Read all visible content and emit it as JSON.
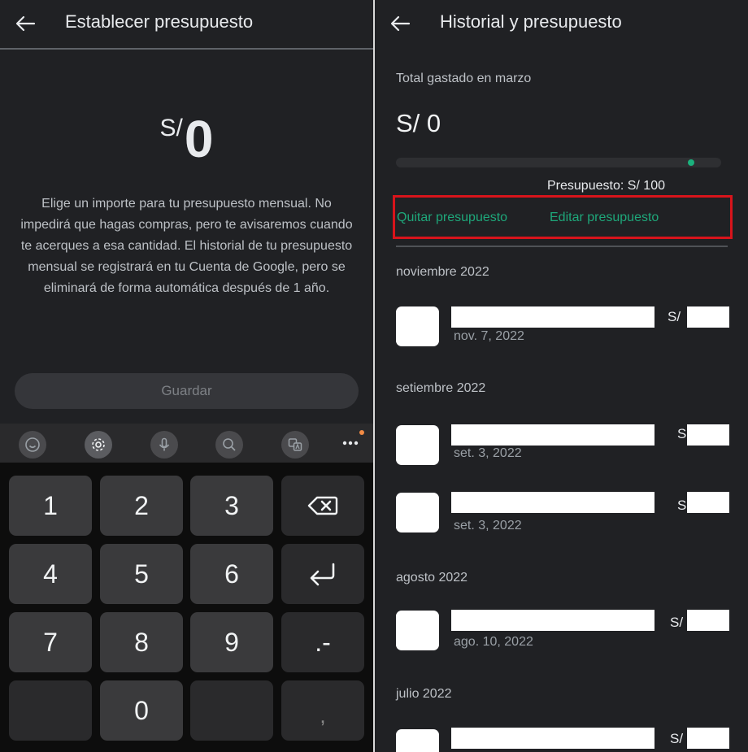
{
  "left": {
    "title": "Establecer presupuesto",
    "amount": {
      "currency": "S/",
      "value": "0"
    },
    "description": "Elige un importe para tu presupuesto mensual. No impedirá que hagas compras, pero te avisaremos cuando te acerques a esa cantidad. El historial de tu presupuesto mensual se registrará en tu Cuenta de Google, pero se eliminará de forma automática después de 1 año.",
    "save_label": "Guardar",
    "keyboard": {
      "toolbar_icons": [
        "emoji-icon",
        "settings-icon",
        "mic-icon",
        "search-icon",
        "translate-icon"
      ],
      "keys": [
        "1",
        "2",
        "3",
        "4",
        "5",
        "6",
        "7",
        "8",
        "9",
        ".-",
        "0",
        ","
      ]
    }
  },
  "right": {
    "title": "Historial y presupuesto",
    "total_label": "Total gastado en marzo",
    "total_value": "S/ 0",
    "budget_label": "Presupuesto: S/ 100",
    "progress": 0,
    "remove_label": "Quitar presupuesto",
    "edit_label": "Editar presupuesto",
    "months": [
      {
        "label": "noviembre 2022",
        "items": [
          {
            "date": "nov. 7, 2022",
            "currency": "S/"
          }
        ]
      },
      {
        "label": "setiembre 2022",
        "items": [
          {
            "date": "set. 3, 2022",
            "currency": "S"
          },
          {
            "date": "set. 3, 2022",
            "currency": "S"
          }
        ]
      },
      {
        "label": "agosto 2022",
        "items": [
          {
            "date": "ago. 10, 2022",
            "currency": "S/"
          }
        ]
      },
      {
        "label": "julio 2022",
        "items": [
          {
            "date": "",
            "currency": "S/"
          }
        ]
      }
    ],
    "colors": {
      "accent": "#1ea77a",
      "highlight_box": "#d8141b"
    }
  }
}
